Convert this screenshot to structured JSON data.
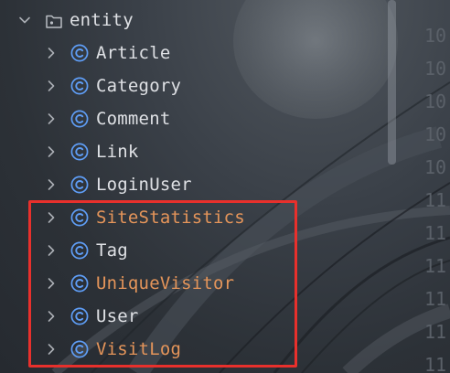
{
  "colors": {
    "text_default": "#dfe1e5",
    "text_modified": "#e5955a",
    "class_icon": "#5f9ef7",
    "line_numbers": "#5a6068",
    "highlight_border": "#e8302c",
    "chevron": "#a9adb3"
  },
  "tree": {
    "package": {
      "label": "entity",
      "icon": "package-folder-icon",
      "expanded": true
    },
    "items": [
      {
        "label": "Article",
        "icon": "class-icon",
        "modified": false
      },
      {
        "label": "Category",
        "icon": "class-icon",
        "modified": false
      },
      {
        "label": "Comment",
        "icon": "class-icon",
        "modified": false
      },
      {
        "label": "Link",
        "icon": "class-icon",
        "modified": false
      },
      {
        "label": "LoginUser",
        "icon": "class-icon",
        "modified": false
      },
      {
        "label": "SiteStatistics",
        "icon": "class-icon",
        "modified": true
      },
      {
        "label": "Tag",
        "icon": "class-icon",
        "modified": false
      },
      {
        "label": "UniqueVisitor",
        "icon": "class-icon",
        "modified": true
      },
      {
        "label": "User",
        "icon": "class-icon",
        "modified": false
      },
      {
        "label": "VisitLog",
        "icon": "class-icon",
        "modified": true
      }
    ]
  },
  "gutter": {
    "line_numbers": [
      "10",
      "10",
      "10",
      "10",
      "10",
      "11",
      "11",
      "11",
      "11",
      "11",
      "11"
    ]
  }
}
